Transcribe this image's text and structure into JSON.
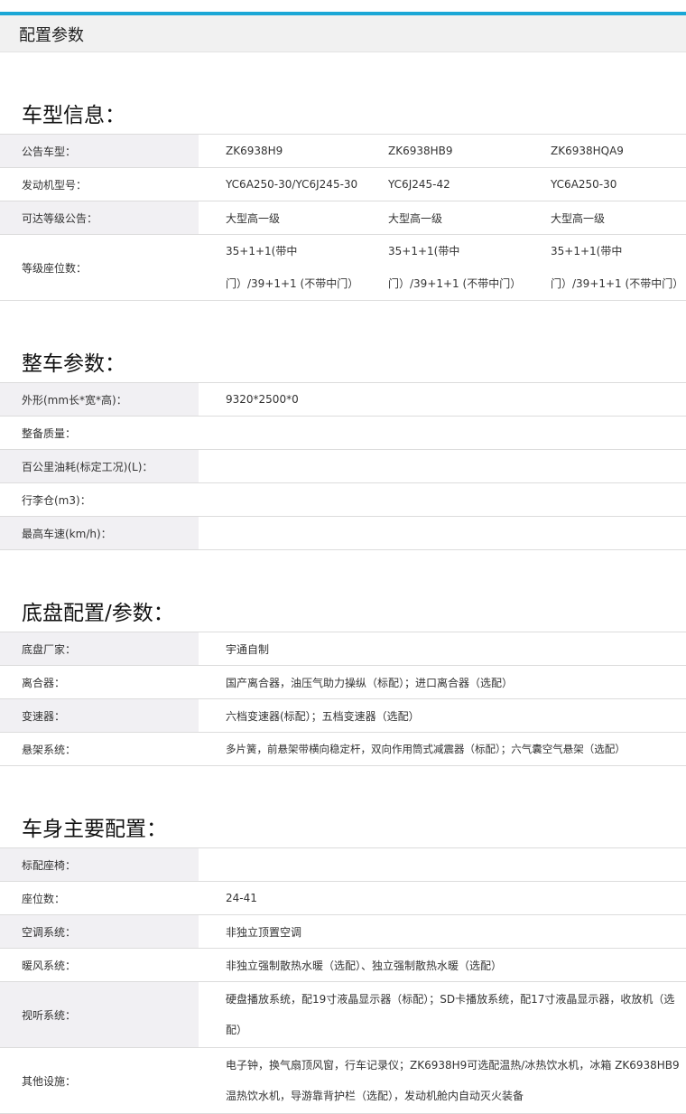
{
  "header": {
    "title": "配置参数"
  },
  "sections": [
    {
      "title": "车型信息：",
      "rows3": [
        {
          "label": "公告车型：",
          "v": [
            "ZK6938H9",
            "ZK6938HB9",
            "ZK6938HQA9"
          ]
        },
        {
          "label": "发动机型号：",
          "v": [
            "YC6A250-30/YC6J245-30",
            "YC6J245-42",
            "YC6A250-30"
          ]
        },
        {
          "label": "可达等级公告：",
          "v": [
            "大型高一级",
            "大型高一级",
            "大型高一级"
          ]
        },
        {
          "label": "等级座位数：",
          "v": [
            "35+1+1(带中门）/39+1+1 (不带中门）",
            "35+1+1(带中门）/39+1+1 (不带中门）",
            "35+1+1(带中门）/39+1+1 (不带中门）"
          ]
        }
      ]
    },
    {
      "title": "整车参数：",
      "rows": [
        {
          "label": "外形(mm长*宽*高)：",
          "value": "9320*2500*0"
        },
        {
          "label": "整备质量：",
          "value": ""
        },
        {
          "label": "百公里油耗(标定工况)(L)：",
          "value": ""
        },
        {
          "label": "行李仓(m3)：",
          "value": ""
        },
        {
          "label": "最高车速(km/h)：",
          "value": ""
        }
      ]
    },
    {
      "title": "底盘配置/参数：",
      "rows": [
        {
          "label": "底盘厂家：",
          "value": "宇通自制"
        },
        {
          "label": "离合器：",
          "value": "国产离合器，油压气助力操纵（标配）；进口离合器（选配）"
        },
        {
          "label": "变速器：",
          "value": "六档变速器(标配）；五档变速器（选配）"
        },
        {
          "label": "悬架系统：",
          "value": "多片簧，前悬架带横向稳定杆，双向作用筒式减震器（标配）；六气囊空气悬架（选配）"
        }
      ]
    },
    {
      "title": "车身主要配置：",
      "rows": [
        {
          "label": "标配座椅：",
          "value": ""
        },
        {
          "label": "座位数：",
          "value": "24-41"
        },
        {
          "label": "空调系统：",
          "value": "非独立顶置空调"
        },
        {
          "label": "暖风系统：",
          "value": "非独立强制散热水暖（选配）、独立强制散热水暖（选配）"
        },
        {
          "label": "视听系统：",
          "value": "硬盘播放系统，配19寸液晶显示器（标配）；SD卡播放系统，配17寸液晶显示器，收放机（选配）"
        },
        {
          "label": "其他设施：",
          "value": "电子钟，换气扇顶风窗，行车记录仪；ZK6938H9可选配温热/冰热饮水机，冰箱 ZK6938HB9温热饮水机，导游靠背护栏（选配），发动机舱内自动灭火装备"
        }
      ]
    }
  ]
}
